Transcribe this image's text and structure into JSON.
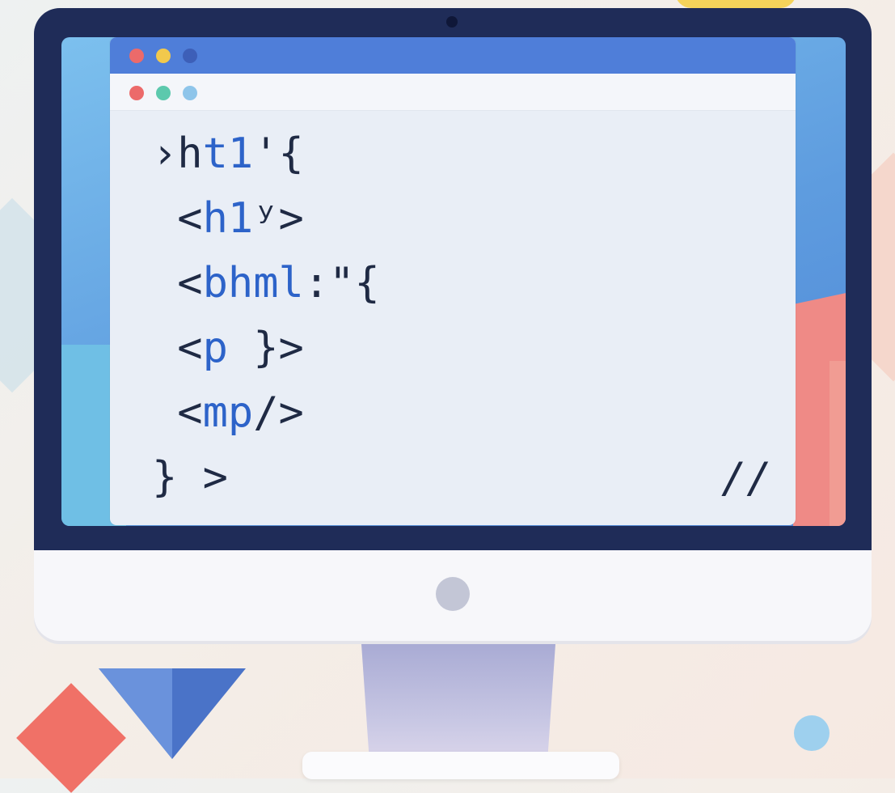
{
  "code_lines": [
    {
      "a": "›h",
      "b": "t1",
      "c": "'{"
    },
    {
      "a": " <",
      "b": "h1",
      "c": "ʸ>"
    },
    {
      "a": " <",
      "b": "bhml",
      "c": ":\"{"
    },
    {
      "a": " <",
      "b": "p",
      "c": " }>"
    },
    {
      "a": " <",
      "b": "mp",
      "c": "/>"
    },
    {
      "a": "}",
      "b": "",
      "c": " >"
    }
  ],
  "comment_mark": "//",
  "colors": {
    "window_close_dot": "#ec6a6a",
    "window_min_dot": "#f2c94c",
    "window_max_dot": "#3d5fb8",
    "tab_dot_red": "#ec6a6a",
    "tab_dot_green": "#5cc9ad",
    "tab_dot_blue": "#8ec5ea",
    "keyword": "#2d63c9",
    "text": "#1f2a44"
  }
}
